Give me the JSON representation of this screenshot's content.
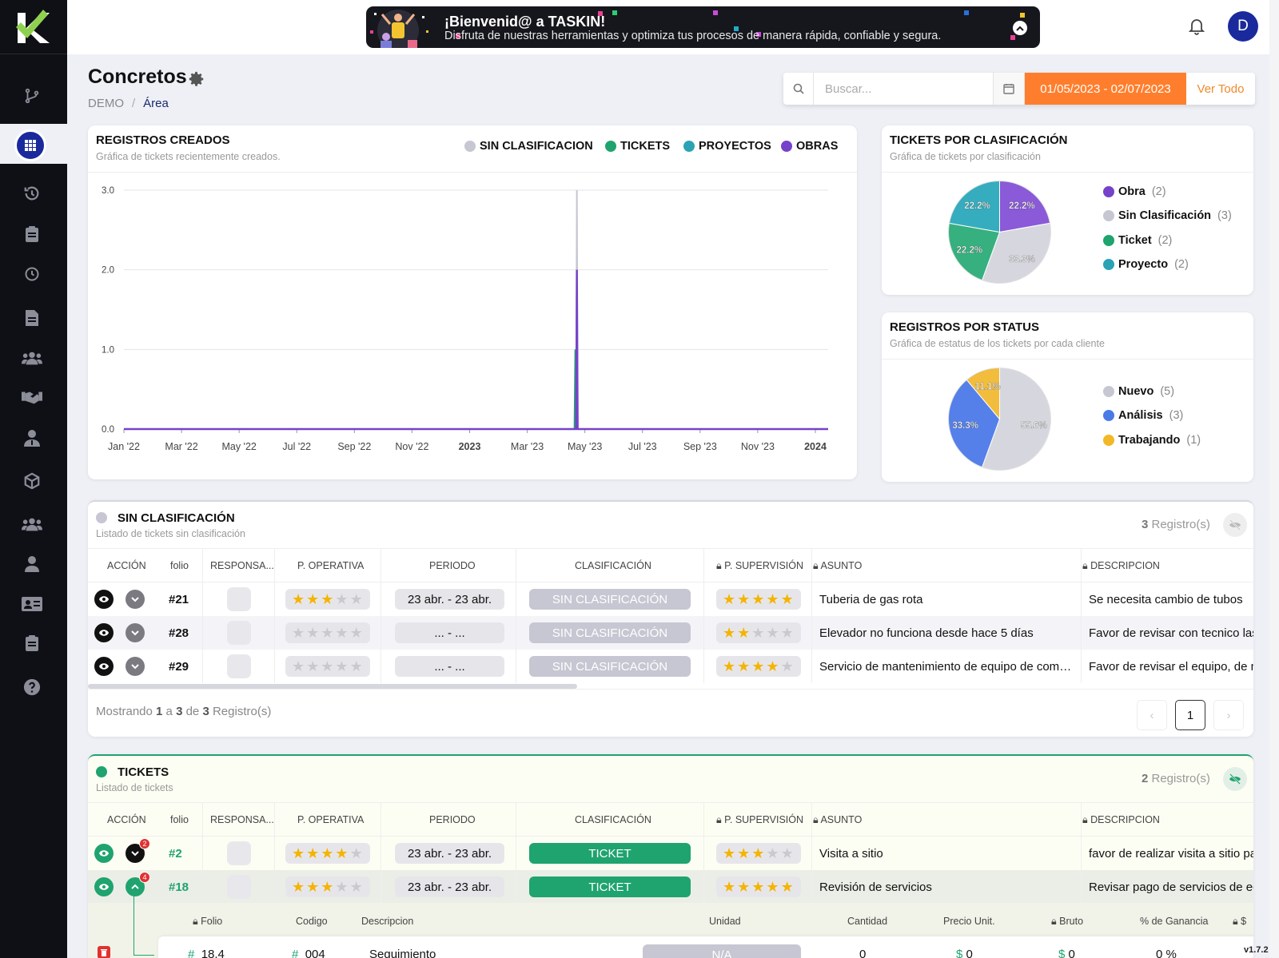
{
  "banner": {
    "title": "¡Bienvenid@ a TASKIN!",
    "subtitle": "Disfruta de nuestras herramientas y optimiza tus procesos de manera rápida, confiable y segura."
  },
  "user": {
    "initial": "D"
  },
  "page": {
    "title": "Concretos",
    "breadcrumb_root": "DEMO",
    "breadcrumb_current": "Área"
  },
  "search": {
    "placeholder": "Buscar...",
    "date_range": "01/05/2023 - 02/07/2023",
    "view_all": "Ver Todo"
  },
  "colors": {
    "sin_clasificacion": "#c6c7d2",
    "tickets": "#1fa36f",
    "proyectos": "#2ba3b5",
    "obras": "#7642c9",
    "accent": "#ff7e2d",
    "brand": "#1a2a9c"
  },
  "registros_creados": {
    "title": "REGISTROS CREADOS",
    "subtitle": "Gráfica de tickets recientemente creados.",
    "legend": [
      "SIN CLASIFICACION",
      "TICKETS",
      "PROYECTOS",
      "OBRAS"
    ]
  },
  "tickets_por_clasificacion": {
    "title": "TICKETS POR CLASIFICACIÓN",
    "subtitle": "Gráfica de tickets por clasificación",
    "legend": [
      {
        "label": "Obra",
        "count": "(2)"
      },
      {
        "label": "Sin Clasificación",
        "count": "(3)"
      },
      {
        "label": "Ticket",
        "count": "(2)"
      },
      {
        "label": "Proyecto",
        "count": "(2)"
      }
    ]
  },
  "registros_por_status": {
    "title": "REGISTROS POR STATUS",
    "subtitle": "Gráfica de estatus de los tickets por cada cliente",
    "legend": [
      {
        "label": "Nuevo",
        "count": "(5)"
      },
      {
        "label": "Análisis",
        "count": "(3)"
      },
      {
        "label": "Trabajando",
        "count": "(1)"
      }
    ]
  },
  "chart_data": [
    {
      "type": "line",
      "title": "REGISTROS CREADOS",
      "x": [
        "Jan '22",
        "Mar '22",
        "May '22",
        "Jul '22",
        "Sep '22",
        "Nov '22",
        "2023",
        "Mar '23",
        "May '23",
        "Jul '23",
        "Sep '23",
        "Nov '23",
        "2024"
      ],
      "yticks": [
        "0.0",
        "1.0",
        "2.0",
        "3.0"
      ],
      "ylim": [
        0,
        3
      ],
      "spike_date": "2023-04-23",
      "series": [
        {
          "name": "SIN CLASIFICACION",
          "color": "#c6c7d2",
          "spike_value": 3
        },
        {
          "name": "TICKETS",
          "color": "#1fa36f",
          "spike_value": 1
        },
        {
          "name": "PROYECTOS",
          "color": "#2ba3b5",
          "spike_value": 0
        },
        {
          "name": "OBRAS",
          "color": "#7642c9",
          "spike_value": 2
        }
      ],
      "legend_position": "top-right",
      "grid": true
    },
    {
      "type": "pie",
      "title": "TICKETS POR CLASIFICACIÓN",
      "slices": [
        {
          "label": "Obra",
          "value": 2,
          "pct": "22.2%",
          "color": "#8a5ad8"
        },
        {
          "label": "Sin Clasificación",
          "value": 3,
          "pct": "33.3%",
          "color": "#d6d7de"
        },
        {
          "label": "Ticket",
          "value": 2,
          "pct": "22.2%",
          "color": "#35b07e"
        },
        {
          "label": "Proyecto",
          "value": 2,
          "pct": "22.2%",
          "color": "#35adbe"
        }
      ]
    },
    {
      "type": "pie",
      "title": "REGISTROS POR STATUS",
      "slices": [
        {
          "label": "Nuevo",
          "value": 5,
          "pct": "55.6%",
          "color": "#d6d7de"
        },
        {
          "label": "Análisis",
          "value": 3,
          "pct": "33.3%",
          "color": "#5580ea"
        },
        {
          "label": "Trabajando",
          "value": 1,
          "pct": "11.1%",
          "color": "#f2bc3c"
        }
      ]
    }
  ],
  "columns": {
    "accion": "ACCIÓN",
    "folio": "folio",
    "responsable": "RESPONSA...",
    "p_operativa": "P. OPERATIVA",
    "periodo": "PERIODO",
    "clasificacion": "CLASIFICACIÓN",
    "p_supervision": "P. SUPERVISIÓN",
    "asunto": "ASUNTO",
    "descripcion": "DESCRIPCION"
  },
  "sin_clasificacion": {
    "title": "SIN CLASIFICACIÓN",
    "subtitle": "Listado de tickets sin clasificación",
    "count_num": "3",
    "count_label": " Registro(s)",
    "rows": [
      {
        "folio": "#21",
        "p_operativa": 3,
        "periodo": "23 abr. - 23 abr.",
        "clasificacion": "SIN CLASIFICACIÓN",
        "p_supervision": 5,
        "asunto": "Tuberia de gas rota",
        "descripcion": "Se necesita cambio de tubos"
      },
      {
        "folio": "#28",
        "p_operativa": 0,
        "periodo": "... - ...",
        "clasificacion": "SIN CLASIFICACIÓN",
        "p_supervision": 2,
        "asunto": "Elevador no funciona desde hace 5 días",
        "descripcion": "Favor de revisar con tecnico las"
      },
      {
        "folio": "#29",
        "p_operativa": 0,
        "periodo": "... - ...",
        "clasificacion": "SIN CLASIFICACIÓN",
        "p_supervision": 4,
        "asunto": "Servicio de mantenimiento de equipo de comp...",
        "descripcion": "Favor de revisar el equipo, de m"
      }
    ],
    "footer": {
      "prefix": "Mostrando ",
      "from": "1",
      "a": " a ",
      "to": "3",
      "de": " de ",
      "total": "3",
      "suffix": " Registro(s)"
    },
    "page": "1"
  },
  "tickets": {
    "title": "TICKETS",
    "subtitle": "Listado de tickets",
    "count_num": "2",
    "count_label": " Registro(s)",
    "rows": [
      {
        "folio": "#2",
        "badge": "2",
        "p_operativa": 4,
        "periodo": "23 abr. - 23 abr.",
        "clasificacion": "TICKET",
        "p_supervision": 3,
        "asunto": "Visita a sitio",
        "descripcion": "favor de realizar visita a sitio pa"
      },
      {
        "folio": "#18",
        "badge": "4",
        "p_operativa": 3,
        "periodo": "23 abr. - 23 abr.",
        "clasificacion": "TICKET",
        "p_supervision": 5,
        "asunto": "Revisión de servicios",
        "descripcion": "Revisar pago de servicios de ed"
      }
    ],
    "sub_columns": {
      "folio": "Folio",
      "codigo": "Codigo",
      "descripcion": "Descripcion",
      "unidad": "Unidad",
      "cantidad": "Cantidad",
      "precio": "Precio Unit.",
      "bruto": "Bruto",
      "ganancia": "% de Ganancia",
      "dollar": "$"
    },
    "sub_row": {
      "folio": "18.4",
      "codigo": "004",
      "descripcion": "Seguimiento",
      "unidad": "N/A",
      "cantidad": "0",
      "precio": "0",
      "bruto": "0",
      "ganancia": "0 %"
    }
  },
  "version": "v1.7.2"
}
